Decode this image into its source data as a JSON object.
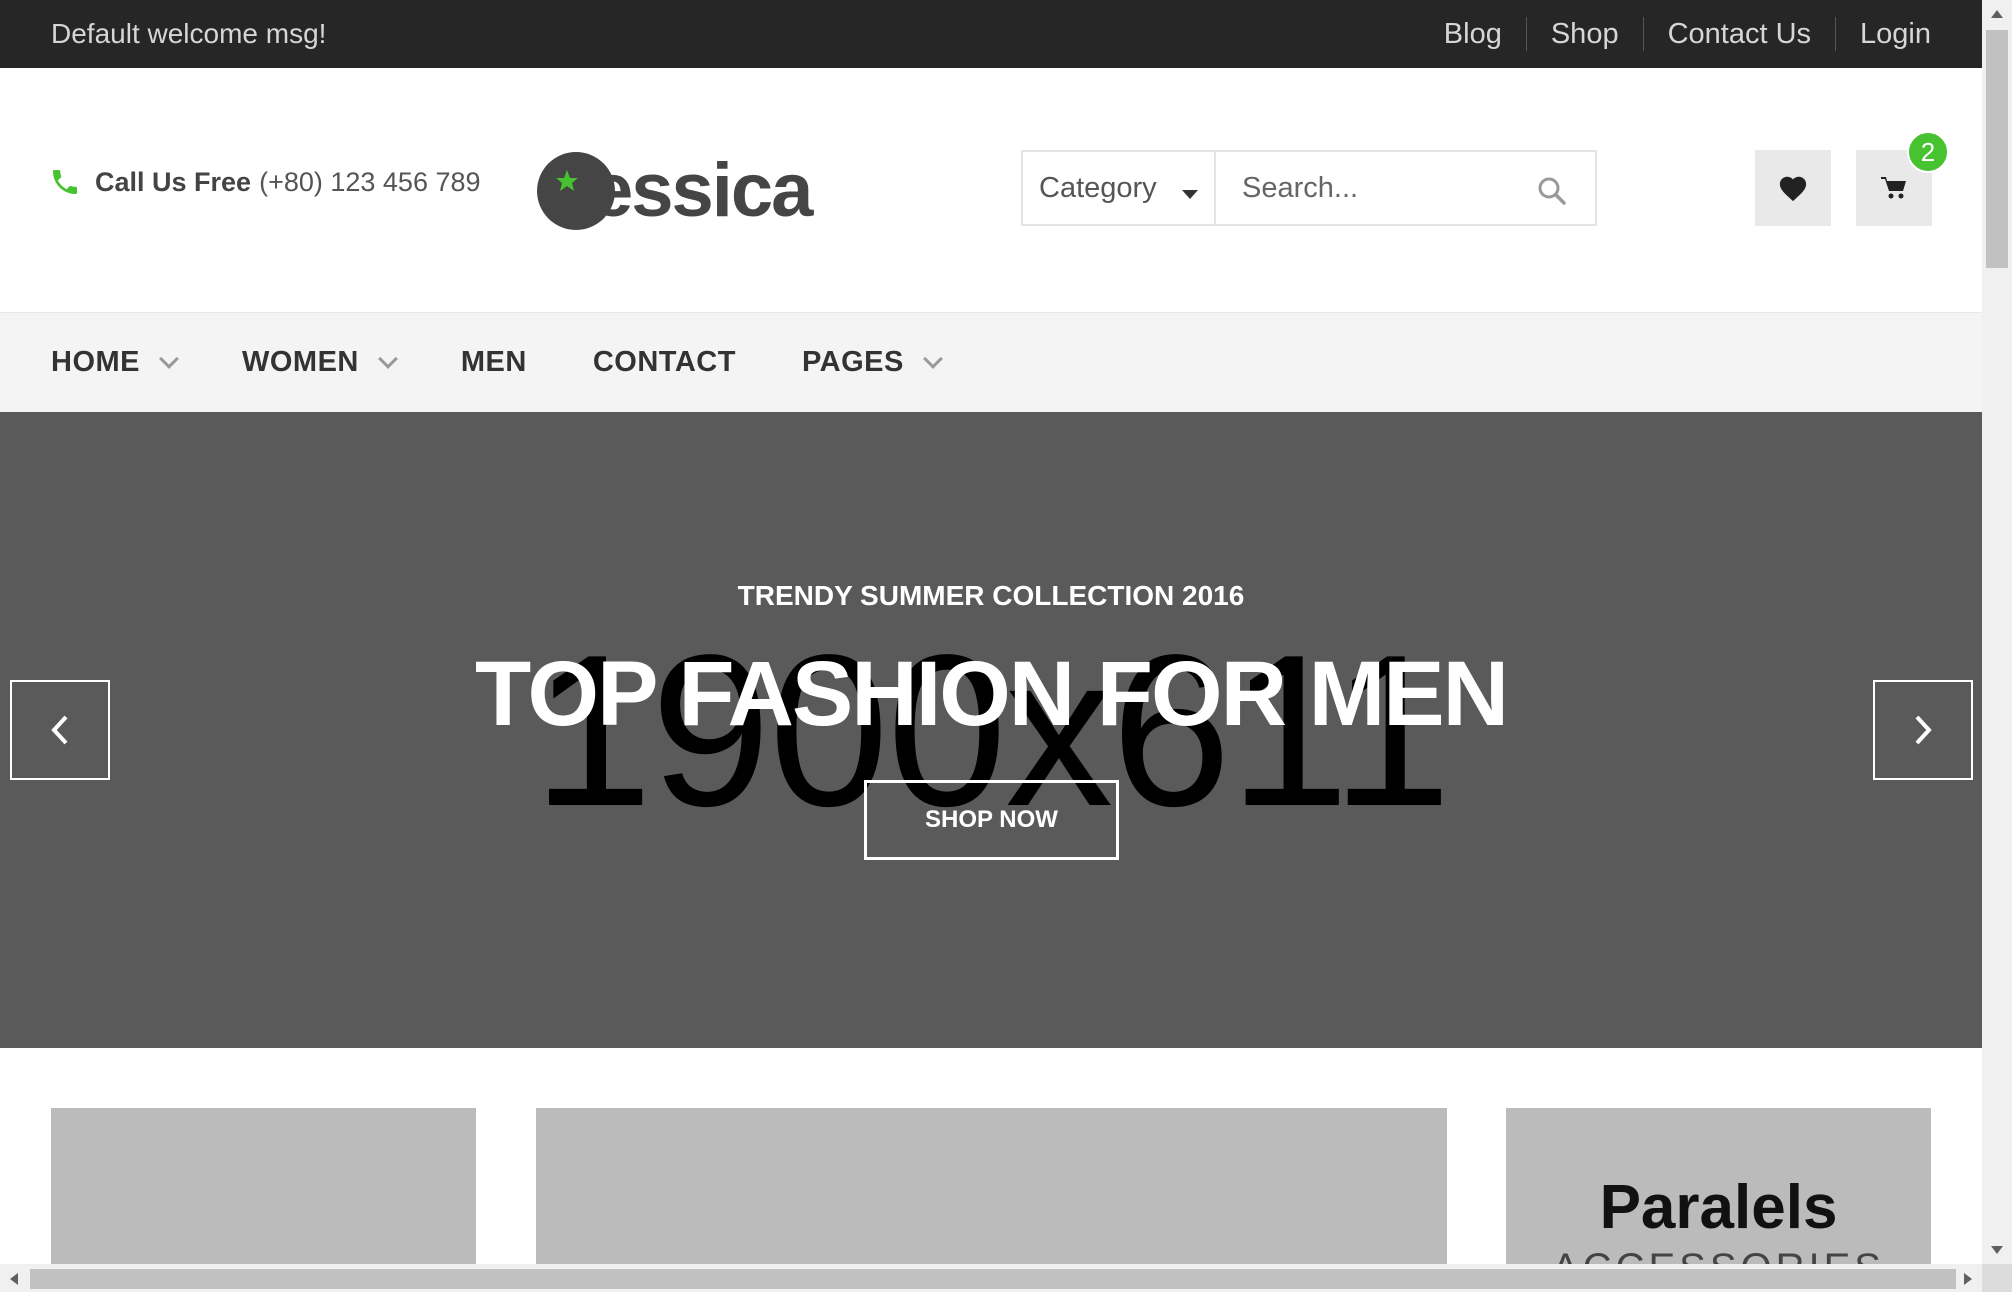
{
  "topbar": {
    "welcome": "Default welcome msg!",
    "links": [
      "Blog",
      "Shop",
      "Contact Us",
      "Login"
    ]
  },
  "header": {
    "call_label": "Call Us Free",
    "call_number": "(+80) 123 456 789",
    "logo_text": "essica",
    "category_label": "Category",
    "search_placeholder": "Search...",
    "cart_count": "2",
    "accent_color": "#47c230"
  },
  "nav": {
    "items": [
      {
        "label": "HOME",
        "dropdown": true
      },
      {
        "label": "WOMEN",
        "dropdown": true
      },
      {
        "label": "MEN",
        "dropdown": false
      },
      {
        "label": "CONTACT",
        "dropdown": false
      },
      {
        "label": "PAGES",
        "dropdown": true
      }
    ]
  },
  "hero": {
    "placeholder": "1900x611",
    "subtitle": "TRENDY SUMMER COLLECTION 2016",
    "title": "TOP FASHION FOR MEN",
    "button": "SHOP NOW",
    "background": "#5a5a5a"
  },
  "banners": {
    "third_title": "Paralels",
    "third_sub": "ACCESSORIES"
  }
}
